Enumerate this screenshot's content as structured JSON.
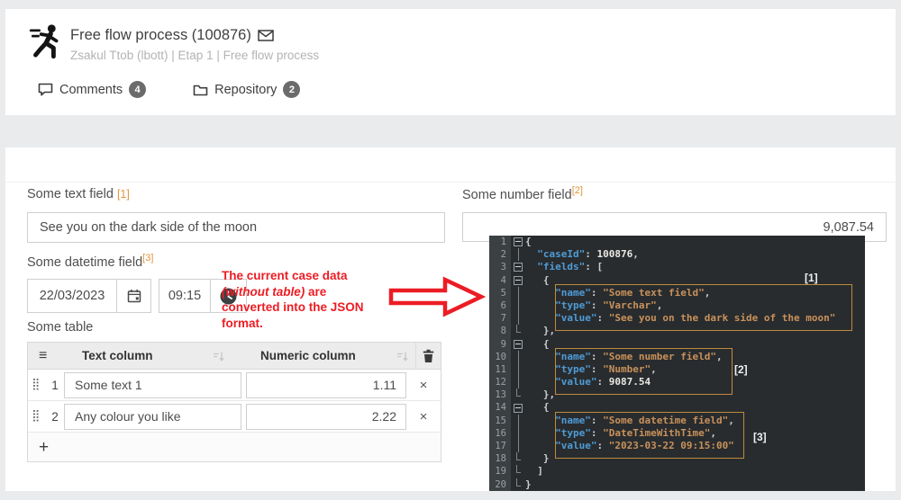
{
  "header": {
    "title": "Free flow process (100876)",
    "subtitle": "Zsakul Ttob (lbott) | Etap 1 | Free flow process",
    "tabs": [
      {
        "label": "Comments",
        "count": "4"
      },
      {
        "label": "Repository",
        "count": "2"
      }
    ]
  },
  "form": {
    "text_field": {
      "label": "Some text field",
      "marker": "[1]",
      "value": "See you on the dark side of the moon"
    },
    "number_field": {
      "label": "Some number field",
      "marker": "[2]",
      "value": "9,087.54"
    },
    "datetime_field": {
      "label": "Some datetime field",
      "marker": "[3]",
      "date": "22/03/2023",
      "time": "09:15"
    },
    "table": {
      "label": "Some table",
      "columns": {
        "text": "Text column",
        "numeric": "Numeric column"
      },
      "rows": [
        {
          "index": "1",
          "text": "Some text 1",
          "number": "1.11",
          "delete": "×"
        },
        {
          "index": "2",
          "text": "Any colour you like",
          "number": "2.22",
          "delete": "×"
        }
      ],
      "add_label": "+"
    }
  },
  "annotation": {
    "line1": "The current case data",
    "line2_italic": "(without table)",
    "line2_rest": " are",
    "line3": "converted into the JSON",
    "line4": "format."
  },
  "editor": {
    "labels": [
      "[1]",
      "[2]",
      "[3]"
    ],
    "lines": [
      {
        "n": 1,
        "fold": "box",
        "seg": [
          [
            "p",
            "{"
          ]
        ]
      },
      {
        "n": 2,
        "fold": "line",
        "seg": [
          [
            "p",
            "  "
          ],
          [
            "k",
            "\"caseId\""
          ],
          [
            "p",
            ": "
          ],
          [
            "n",
            "100876"
          ],
          [
            "p",
            ","
          ]
        ]
      },
      {
        "n": 3,
        "fold": "box",
        "seg": [
          [
            "p",
            "  "
          ],
          [
            "k",
            "\"fields\""
          ],
          [
            "p",
            ": ["
          ]
        ]
      },
      {
        "n": 4,
        "fold": "box",
        "seg": [
          [
            "p",
            "   {"
          ]
        ]
      },
      {
        "n": 5,
        "fold": "line",
        "seg": [
          [
            "p",
            "     "
          ],
          [
            "k",
            "\"name\""
          ],
          [
            "p",
            ": "
          ],
          [
            "s",
            "\"Some text field\""
          ],
          [
            "p",
            ","
          ]
        ]
      },
      {
        "n": 6,
        "fold": "line",
        "seg": [
          [
            "p",
            "     "
          ],
          [
            "k",
            "\"type\""
          ],
          [
            "p",
            ": "
          ],
          [
            "s",
            "\"Varchar\""
          ],
          [
            "p",
            ","
          ]
        ]
      },
      {
        "n": 7,
        "fold": "line",
        "seg": [
          [
            "p",
            "     "
          ],
          [
            "k",
            "\"value\""
          ],
          [
            "p",
            ": "
          ],
          [
            "s",
            "\"See you on the dark side of the moon\""
          ]
        ]
      },
      {
        "n": 8,
        "fold": "end",
        "seg": [
          [
            "p",
            "   },"
          ]
        ]
      },
      {
        "n": 9,
        "fold": "box",
        "seg": [
          [
            "p",
            "   {"
          ]
        ]
      },
      {
        "n": 10,
        "fold": "line",
        "seg": [
          [
            "p",
            "     "
          ],
          [
            "k",
            "\"name\""
          ],
          [
            "p",
            ": "
          ],
          [
            "s",
            "\"Some number field\""
          ],
          [
            "p",
            ","
          ]
        ]
      },
      {
        "n": 11,
        "fold": "line",
        "seg": [
          [
            "p",
            "     "
          ],
          [
            "k",
            "\"type\""
          ],
          [
            "p",
            ": "
          ],
          [
            "s",
            "\"Number\""
          ],
          [
            "p",
            ","
          ]
        ]
      },
      {
        "n": 12,
        "fold": "line",
        "seg": [
          [
            "p",
            "     "
          ],
          [
            "k",
            "\"value\""
          ],
          [
            "p",
            ": "
          ],
          [
            "n",
            "9087.54"
          ]
        ]
      },
      {
        "n": 13,
        "fold": "end",
        "seg": [
          [
            "p",
            "   },"
          ]
        ]
      },
      {
        "n": 14,
        "fold": "box",
        "seg": [
          [
            "p",
            "   {"
          ]
        ]
      },
      {
        "n": 15,
        "fold": "line",
        "seg": [
          [
            "p",
            "     "
          ],
          [
            "k",
            "\"name\""
          ],
          [
            "p",
            ": "
          ],
          [
            "s",
            "\"Some datetime field\""
          ],
          [
            "p",
            ","
          ]
        ]
      },
      {
        "n": 16,
        "fold": "line",
        "seg": [
          [
            "p",
            "     "
          ],
          [
            "k",
            "\"type\""
          ],
          [
            "p",
            ": "
          ],
          [
            "s",
            "\"DateTimeWithTime\""
          ],
          [
            "p",
            ","
          ]
        ]
      },
      {
        "n": 17,
        "fold": "line",
        "seg": [
          [
            "p",
            "     "
          ],
          [
            "k",
            "\"value\""
          ],
          [
            "p",
            ": "
          ],
          [
            "s",
            "\"2023-03-22 09:15:00\""
          ]
        ]
      },
      {
        "n": 18,
        "fold": "end",
        "seg": [
          [
            "p",
            "   }"
          ]
        ]
      },
      {
        "n": 19,
        "fold": "end",
        "seg": [
          [
            "p",
            "  ]"
          ]
        ]
      },
      {
        "n": 20,
        "fold": "end",
        "seg": [
          [
            "p",
            "}"
          ]
        ]
      }
    ]
  },
  "colors": {
    "accent_orange": "#e2953e",
    "annotation_red": "#ed1c24",
    "editor_bg": "#282c2f",
    "editor_key_blue": "#4f9cd6",
    "editor_string_orange": "#c9915a",
    "badge_gray": "#6b6b6b"
  }
}
